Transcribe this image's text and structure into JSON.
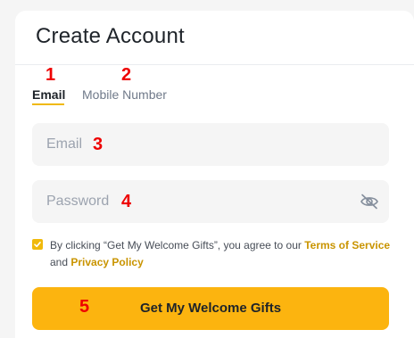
{
  "header": {
    "title": "Create Account"
  },
  "tabs": [
    {
      "label": "Email",
      "active": true
    },
    {
      "label": "Mobile Number",
      "active": false
    }
  ],
  "form": {
    "email": {
      "placeholder": "Email",
      "value": ""
    },
    "password": {
      "placeholder": "Password",
      "value": "",
      "toggle_icon": "eye-off-icon"
    },
    "agreement": {
      "checked": true,
      "text_before": "By clicking “Get My Welcome Gifts”, you agree to our",
      "terms_link": "Terms of Service",
      "text_and": "and",
      "privacy_link": "Privacy Policy"
    },
    "submit_label": "Get My Welcome Gifts"
  },
  "annotations": [
    "1",
    "2",
    "3",
    "4",
    "5"
  ],
  "colors": {
    "accent": "#f0b90b",
    "button": "#fcb40f",
    "link": "#c99400",
    "marker": "#ee0000",
    "field_bg": "#f5f5f5"
  }
}
